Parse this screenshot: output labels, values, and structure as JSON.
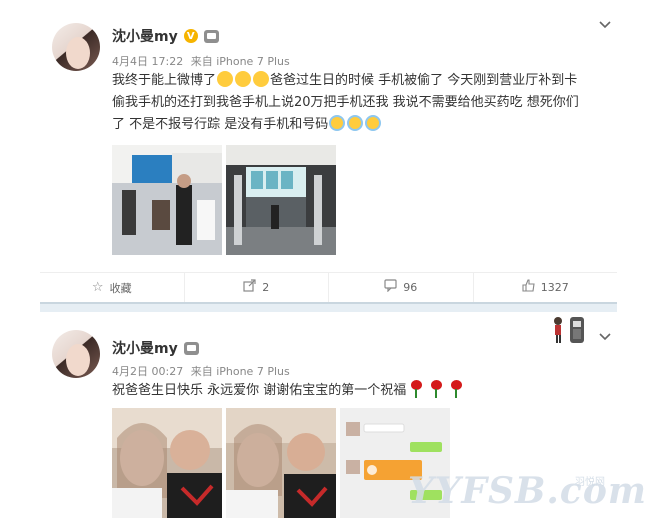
{
  "posts": [
    {
      "username": "沈小曼my",
      "verified": "V",
      "date": "4月4日 17:22",
      "source": "来自 iPhone 7 Plus",
      "text_part1": "我终于能上微博了",
      "text_part2": "爸爸过生日的时候 手机被偷了 今天刚到营业厅补到卡 偷我手机的还打到我爸手机上说20万把手机还我 我说不需要给他买药吃 想死你们了 不是不报号行踪 是没有手机和号码",
      "actions": {
        "favorite_label": "收藏",
        "repost_count": "2",
        "comment_count": "96",
        "like_count": "1327"
      }
    },
    {
      "username": "沈小曼my",
      "date": "4月2日 00:27",
      "source": "来自 iPhone 7 Plus",
      "text": "祝爸爸生日快乐 永远爱你  谢谢佑宝宝的第一个祝福"
    }
  ],
  "watermark": {
    "text": "YYFSB.com",
    "sub": "羽悦网"
  },
  "colors": {
    "accent_orange": "#f6b400",
    "separator": "#e6eef4"
  }
}
